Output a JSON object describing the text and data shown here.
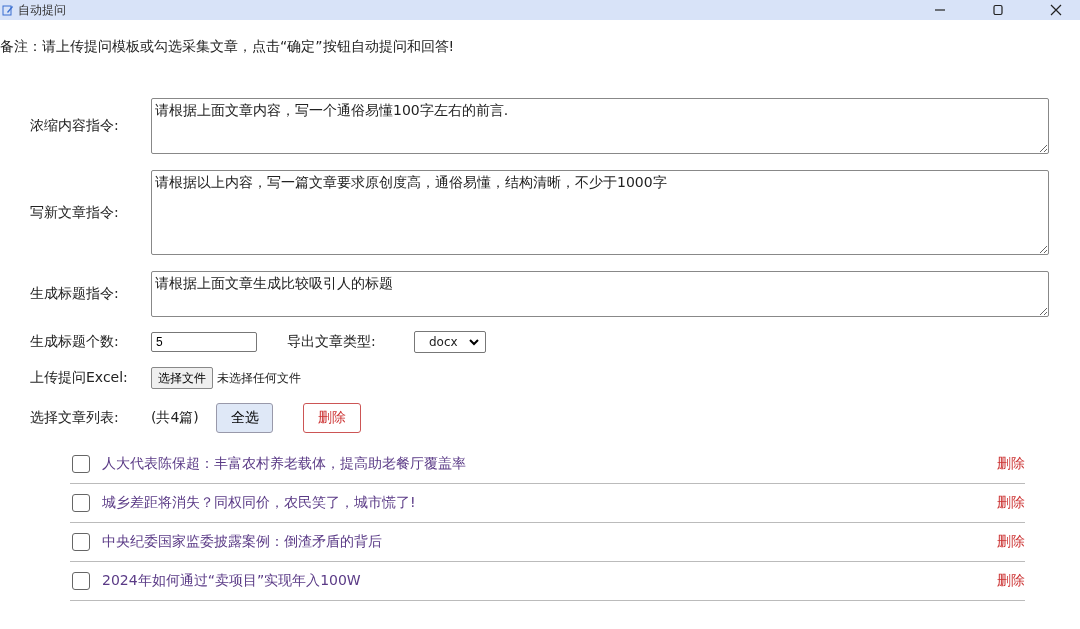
{
  "window": {
    "title": "自动提问"
  },
  "note": "备注：请上传提问模板或勾选采集文章，点击“确定”按钮自动提问和回答!",
  "prompts": [
    {
      "label": "浓缩内容指令:",
      "value": "请根据上面文章内容，写一个通俗易懂100字左右的前言."
    },
    {
      "label": "写新文章指令:",
      "value": "请根据以上内容，写一篇文章要求原创度高，通俗易懂，结构清晰，不少于1000字"
    },
    {
      "label": "生成标题指令:",
      "value": "请根据上面文章生成比较吸引人的标题"
    }
  ],
  "title_count": {
    "label": "生成标题个数:",
    "value": "5"
  },
  "export_type": {
    "label": "导出文章类型:",
    "value": "docx"
  },
  "upload": {
    "label": "上传提问Excel:",
    "button": "选择文件",
    "status": "未选择任何文件"
  },
  "article_list": {
    "label": "选择文章列表:",
    "count": "(共4篇)",
    "select_all": "全选",
    "delete": "删除"
  },
  "articles": [
    {
      "title": "人大代表陈保超：丰富农村养老载体，提高助老餐厅覆盖率",
      "checked": false,
      "action": "删除"
    },
    {
      "title": "城乡差距将消失？同权同价，农民笑了，城市慌了!",
      "checked": false,
      "action": "删除"
    },
    {
      "title": "中央纪委国家监委披露案例：倒渣矛盾的背后",
      "checked": false,
      "action": "删除"
    },
    {
      "title": "2024年如何通过“卖项目”实现年入100W",
      "checked": false,
      "action": "删除"
    }
  ]
}
